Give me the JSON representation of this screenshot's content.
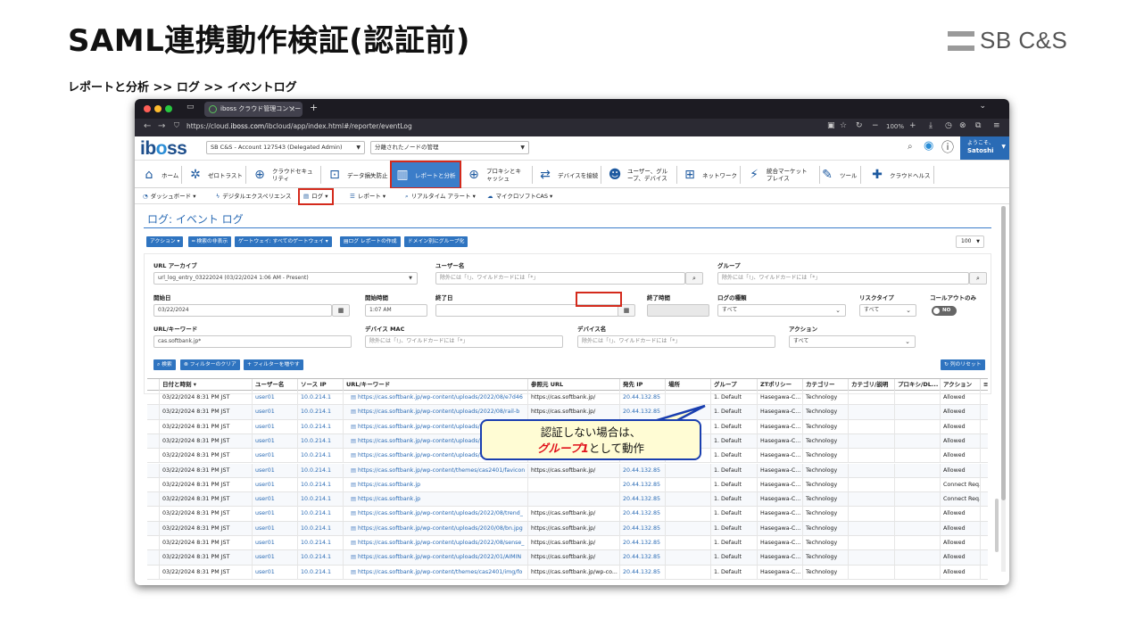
{
  "slide": {
    "title": "SAML連携動作検証(認証前)",
    "breadcrumb": "レポートと分析 >> ログ >> イベントログ",
    "logo_text": "SB C&S"
  },
  "browser": {
    "tab_title": "iboss クラウド管理コンソール",
    "url_prefix": "https://cloud.",
    "url_host": "iboss.com",
    "url_path": "/ibcloud/app/index.html#/reporter/eventLog",
    "zoom": "100%"
  },
  "app": {
    "account": "SB C&S - Account 127543 (Delegated Admin)",
    "node": "分離されたノードの管理",
    "greeting": "ようこそ、",
    "user": "Satoshi"
  },
  "mainnav": [
    "ホーム",
    "ゼロトラスト",
    "クラウドセキュリティ",
    "データ損失防止",
    "レポートと分析",
    "プロキシとキャッシュ",
    "デバイスを接続",
    "ユーザー、グループ、デバイス",
    "ネットワーク",
    "統合マーケットプレイス",
    "ツール",
    "クラウドヘルス"
  ],
  "subnav": [
    "ダッシュボード ▾",
    "デジタルエクスペリエンス",
    "ログ ▾",
    "レポート ▾",
    "リアルタイム アラート ▾",
    "マイクロソフトCAS ▾"
  ],
  "page": {
    "title": "ログ: イベント ログ",
    "page_size": "100"
  },
  "actions": [
    "アクション ▾",
    "━ 検索の非表示",
    "ゲートウェイ: すべてのゲートウェイ ▾",
    "ログ レポートの作成",
    "ドメイン別にグループ化"
  ],
  "filters": {
    "url_archive_label": "URL アーカイブ",
    "url_archive_value": "url_log_entry_03222024 (03/22/2024 1:06 AM - Present)",
    "user_label": "ユーザー名",
    "user_ph": "除外には「!」、ワイルドカードには「*」",
    "group_label": "グループ",
    "group_ph": "除外には「!」、ワイルドカードには「*」",
    "start_date_label": "開始日",
    "start_date": "03/22/2024",
    "start_time_label": "開始時間",
    "start_time": "1:07 AM",
    "end_date_label": "終了日",
    "end_time_label": "終了時間",
    "log_type_label": "ログの種類",
    "log_type": "すべて",
    "risk_label": "リスクタイプ",
    "risk": "すべて",
    "callout_label": "コールアウトのみ",
    "callout_toggle": "NO",
    "url_kw_label": "URL/キーワード",
    "url_kw": "cas.softbank.jp*",
    "mac_label": "デバイス MAC",
    "mac_ph": "除外には「!」、ワイルドカードには「*」",
    "devname_label": "デバイス名",
    "devname_ph": "除外には「!」、ワイルドカードには「*」",
    "action_label": "アクション",
    "action": "すべて"
  },
  "buttons": {
    "search": "検索",
    "clear": "フィルターのクリア",
    "more": "フィルターを増やす",
    "reset_cols": "列のリセット"
  },
  "table": {
    "columns": [
      "日付と時刻 ▾",
      "ユーザー名",
      "ソース IP",
      "URL/キーワード",
      "参照元 URL",
      "発先 IP",
      "場所",
      "グループ",
      "ZTポリシー",
      "カテゴリー",
      "カテゴリ/説明",
      "プロキシ/DL...",
      "アクション"
    ],
    "rows": [
      {
        "date": "03/22/2024 8:31 PM JST",
        "user": "user01",
        "ip": "10.0.214.1",
        "url": "https://cas.softbank.jp/wp-content/uploads/2022/08/e7d46",
        "ref": "https://cas.softbank.jp/",
        "dst": "20.44.132.85",
        "group": "1. Default",
        "zt": "Hasegawa-C...",
        "cat": "Technology",
        "act": "Allowed"
      },
      {
        "date": "03/22/2024 8:31 PM JST",
        "user": "user01",
        "ip": "10.0.214.1",
        "url": "https://cas.softbank.jp/wp-content/uploads/2022/08/rail-b",
        "ref": "https://cas.softbank.jp/",
        "dst": "20.44.132.85",
        "group": "1. Default",
        "zt": "Hasegawa-C...",
        "cat": "Technology",
        "act": "Allowed"
      },
      {
        "date": "03/22/2024 8:31 PM JST",
        "user": "user01",
        "ip": "10.0.214.1",
        "url": "https://cas.softbank.jp/wp-content/uploads/2022/08/seminar",
        "ref": "https://cas.softbank.jp/",
        "dst": "20.44.132.85",
        "group": "1. Default",
        "zt": "Hasegawa-C...",
        "cat": "Technology",
        "act": "Allowed"
      },
      {
        "date": "03/22/2024 8:31 PM JST",
        "user": "user01",
        "ip": "10.0.214.1",
        "url": "https://cas.softbank.jp/wp-content/uploads/2022/08/banner",
        "ref": "https://cas.softbank.jp/",
        "dst": "20.44.132.85",
        "group": "1. Default",
        "zt": "Hasegawa-C...",
        "cat": "Technology",
        "act": "Allowed"
      },
      {
        "date": "03/22/2024 8:31 PM JST",
        "user": "user01",
        "ip": "10.0.214.1",
        "url": "https://cas.softbank.jp/wp-content/uploads/2022/08/img-b",
        "ref": "https://cas.softbank.jp/",
        "dst": "20.44.132.85",
        "group": "1. Default",
        "zt": "Hasegawa-C...",
        "cat": "Technology",
        "act": "Allowed"
      },
      {
        "date": "03/22/2024 8:31 PM JST",
        "user": "user01",
        "ip": "10.0.214.1",
        "url": "https://cas.softbank.jp/wp-content/themes/cas2401/favicon",
        "ref": "https://cas.softbank.jp/",
        "dst": "20.44.132.85",
        "group": "1. Default",
        "zt": "Hasegawa-C...",
        "cat": "Technology",
        "act": "Allowed"
      },
      {
        "date": "03/22/2024 8:31 PM JST",
        "user": "user01",
        "ip": "10.0.214.1",
        "url": "https://cas.softbank.jp",
        "ref": "",
        "dst": "20.44.132.85",
        "group": "1. Default",
        "zt": "Hasegawa-C...",
        "cat": "Technology",
        "act": "Connect Req..."
      },
      {
        "date": "03/22/2024 8:31 PM JST",
        "user": "user01",
        "ip": "10.0.214.1",
        "url": "https://cas.softbank.jp",
        "ref": "",
        "dst": "20.44.132.85",
        "group": "1. Default",
        "zt": "Hasegawa-C...",
        "cat": "Technology",
        "act": "Connect Req..."
      },
      {
        "date": "03/22/2024 8:31 PM JST",
        "user": "user01",
        "ip": "10.0.214.1",
        "url": "https://cas.softbank.jp/wp-content/uploads/2022/08/trend_",
        "ref": "https://cas.softbank.jp/",
        "dst": "20.44.132.85",
        "group": "1. Default",
        "zt": "Hasegawa-C...",
        "cat": "Technology",
        "act": "Allowed"
      },
      {
        "date": "03/22/2024 8:31 PM JST",
        "user": "user01",
        "ip": "10.0.214.1",
        "url": "https://cas.softbank.jp/wp-content/uploads/2020/08/bn.jpg",
        "ref": "https://cas.softbank.jp/",
        "dst": "20.44.132.85",
        "group": "1. Default",
        "zt": "Hasegawa-C...",
        "cat": "Technology",
        "act": "Allowed"
      },
      {
        "date": "03/22/2024 8:31 PM JST",
        "user": "user01",
        "ip": "10.0.214.1",
        "url": "https://cas.softbank.jp/wp-content/uploads/2022/08/sense_",
        "ref": "https://cas.softbank.jp/",
        "dst": "20.44.132.85",
        "group": "1. Default",
        "zt": "Hasegawa-C...",
        "cat": "Technology",
        "act": "Allowed"
      },
      {
        "date": "03/22/2024 8:31 PM JST",
        "user": "user01",
        "ip": "10.0.214.1",
        "url": "https://cas.softbank.jp/wp-content/uploads/2022/01/AIMIN",
        "ref": "https://cas.softbank.jp/",
        "dst": "20.44.132.85",
        "group": "1. Default",
        "zt": "Hasegawa-C...",
        "cat": "Technology",
        "act": "Allowed"
      },
      {
        "date": "03/22/2024 8:31 PM JST",
        "user": "user01",
        "ip": "10.0.214.1",
        "url": "https://cas.softbank.jp/wp-content/themes/cas2401/img/fo",
        "ref": "https://cas.softbank.jp/wp-co...",
        "dst": "20.44.132.85",
        "group": "1. Default",
        "zt": "Hasegawa-C...",
        "cat": "Technology",
        "act": "Allowed"
      }
    ]
  },
  "callout": {
    "line1": "認証しない場合は、",
    "red": "グループ1",
    "line2": "として動作"
  }
}
